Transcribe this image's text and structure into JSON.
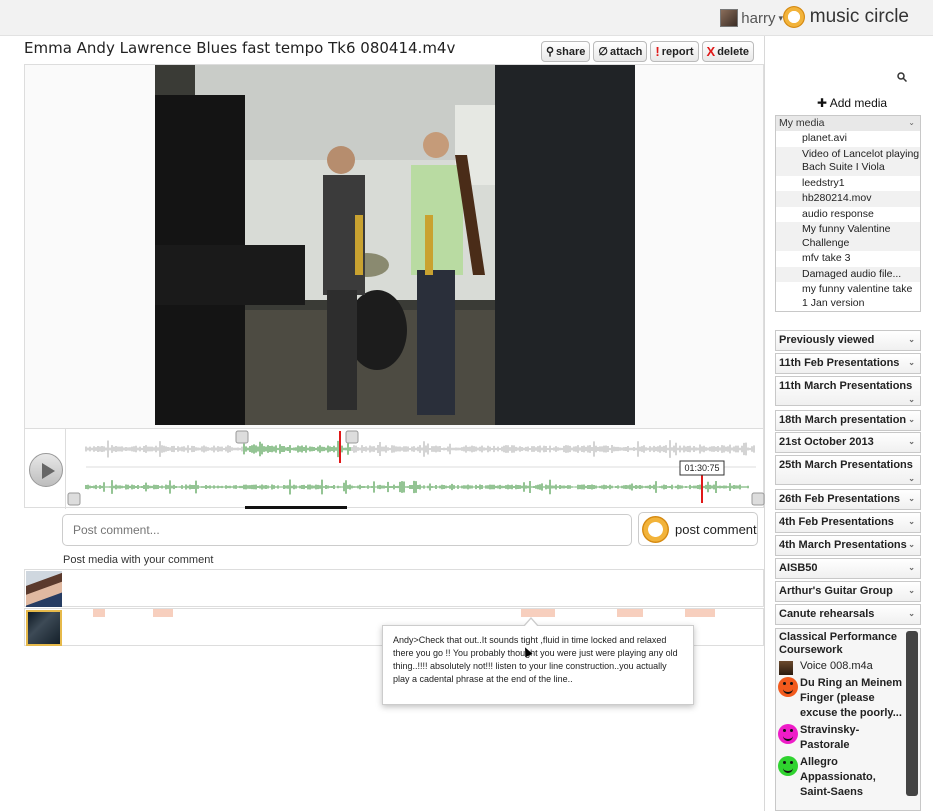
{
  "topbar": {
    "username": "harry",
    "user_chevron": "▾",
    "brand": "music circle"
  },
  "media": {
    "title": "Emma Andy Lawrence Blues fast tempo Tk6 080414.m4v",
    "actions": [
      {
        "icon": "share-icon",
        "glyph": "⚲",
        "label": "share"
      },
      {
        "icon": "attach-icon",
        "glyph": "∅",
        "label": "attach"
      },
      {
        "icon": "report-icon",
        "glyph": "!",
        "label": "report"
      },
      {
        "icon": "delete-icon",
        "glyph": "X",
        "label": "delete"
      }
    ]
  },
  "player": {
    "time_readout": "01:30:75",
    "accent": "#2a8a2a",
    "playhead_color": "#e01818"
  },
  "comment": {
    "placeholder": "Post comment...",
    "post_label": "post comment",
    "post_media_label": "Post media with your comment",
    "popup_text": "Andy>Check that out..It sounds tight ,fluid in time locked and relaxed there you go !! You probably thought you were just were playing any old thing..!!!! absolutely not!!! listen to your line construction..you actually play a cadental phrase at the end of the line.."
  },
  "sidebar": {
    "search_icon": "search-icon",
    "add_media": "Add media",
    "add_media_glyph": "✚",
    "my_media": {
      "label": "My media",
      "items": [
        "planet.avi",
        "Video of Lancelot playing Bach Suite I Viola",
        "leedstry1",
        "hb280214.mov",
        "audio response",
        "My funny Valentine Challenge",
        "mfv take 3",
        "Damaged audio file...",
        "my funny valentine take 1 Jan version"
      ]
    },
    "groups": [
      "Previously viewed",
      "11th Feb Presentations",
      "11th March Presentations",
      "18th March presentation",
      "21st October 2013",
      "25th March Presentations",
      "26th Feb Presentations",
      "4th Feb Presentations",
      "4th March Presentations",
      "AISB50",
      "Arthur's Guitar Group",
      "Canute rehearsals"
    ],
    "classical": {
      "label": "Classical Performance Coursework",
      "items": [
        {
          "icon": "file",
          "name": "Voice 008.m4a"
        },
        {
          "icon": "orange",
          "name": "Du Ring an Meinem Finger (please excuse the poorly..."
        },
        {
          "icon": "pink",
          "name": "Stravinsky- Pastorale"
        },
        {
          "icon": "green",
          "name": "Allegro Appassionato, Saint-Saens"
        }
      ]
    }
  }
}
